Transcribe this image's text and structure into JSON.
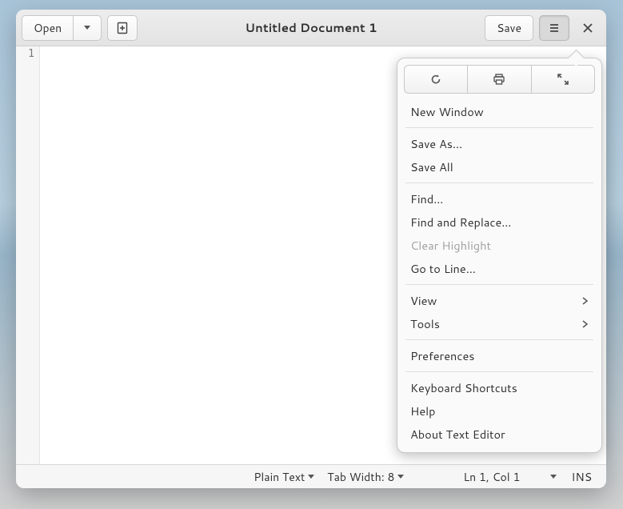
{
  "header": {
    "open_label": "Open",
    "title": "Untitled Document 1",
    "save_label": "Save"
  },
  "gutter": {
    "line1": "1"
  },
  "menu": {
    "new_window": "New Window",
    "save_as": "Save As…",
    "save_all": "Save All",
    "find": "Find…",
    "find_replace": "Find and Replace…",
    "clear_highlight": "Clear Highlight",
    "go_to_line": "Go to Line…",
    "view": "View",
    "tools": "Tools",
    "preferences": "Preferences",
    "keyboard_shortcuts": "Keyboard Shortcuts",
    "help": "Help",
    "about": "About Text Editor"
  },
  "statusbar": {
    "language": "Plain Text",
    "tab_width": "Tab Width: 8",
    "cursor_pos": "Ln 1, Col 1",
    "insert_mode": "INS"
  }
}
